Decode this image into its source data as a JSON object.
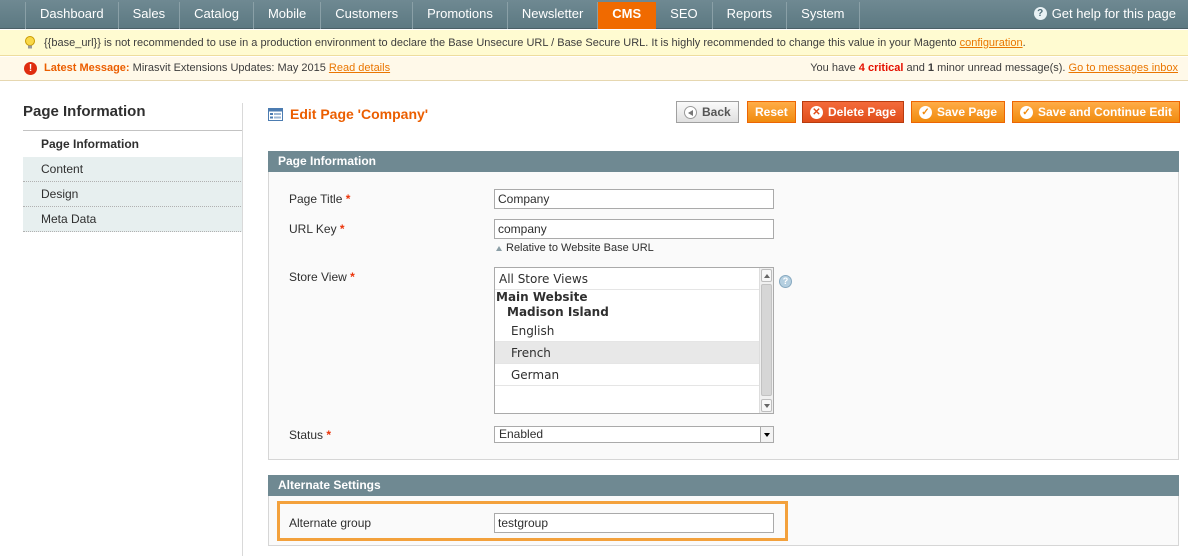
{
  "nav": {
    "items": [
      "Dashboard",
      "Sales",
      "Catalog",
      "Mobile",
      "Customers",
      "Promotions",
      "Newsletter",
      "CMS",
      "SEO",
      "Reports",
      "System"
    ],
    "active": "CMS",
    "help": "Get help for this page"
  },
  "notice": {
    "text": "{{base_url}} is not recommended to use in a production environment to declare the Base Unsecure URL / Base Secure URL. It is highly recommended to change this value in your Magento",
    "link": "configuration",
    "suffix": "."
  },
  "message": {
    "latest_label": "Latest Message:",
    "text": "Mirasvit Extensions Updates: May 2015",
    "read_link": "Read details",
    "you_have": "You have",
    "critical_count": "4 critical",
    "and": "and",
    "minor_count": "1",
    "minor_text": "minor unread message(s).",
    "inbox_link": "Go to messages inbox"
  },
  "sidebar": {
    "title": "Page Information",
    "tabs": [
      "Page Information",
      "Content",
      "Design",
      "Meta Data"
    ],
    "active": "Page Information"
  },
  "header": {
    "title": "Edit Page 'Company'",
    "buttons": {
      "back": "Back",
      "reset": "Reset",
      "delete": "Delete Page",
      "save": "Save Page",
      "save_continue": "Save and Continue Edit"
    }
  },
  "page_info": {
    "legend": "Page Information",
    "title_label": "Page Title",
    "title_value": "Company",
    "url_label": "URL Key",
    "url_value": "company",
    "url_note": "Relative to Website Base URL",
    "store_label": "Store View",
    "store_options": {
      "all": "All Store Views",
      "website": "Main Website",
      "store": "Madison Island",
      "views": [
        "English",
        "French",
        "German"
      ],
      "selected": "French"
    },
    "status_label": "Status",
    "status_value": "Enabled",
    "required_mark": "*"
  },
  "alternate": {
    "legend": "Alternate Settings",
    "group_label": "Alternate group",
    "group_value": "testgroup"
  },
  "colors": {
    "accent": "#eb5e00",
    "header_bar": "#6f8992",
    "active_tab": "#f06a00",
    "highlight": "#f3a13c"
  }
}
